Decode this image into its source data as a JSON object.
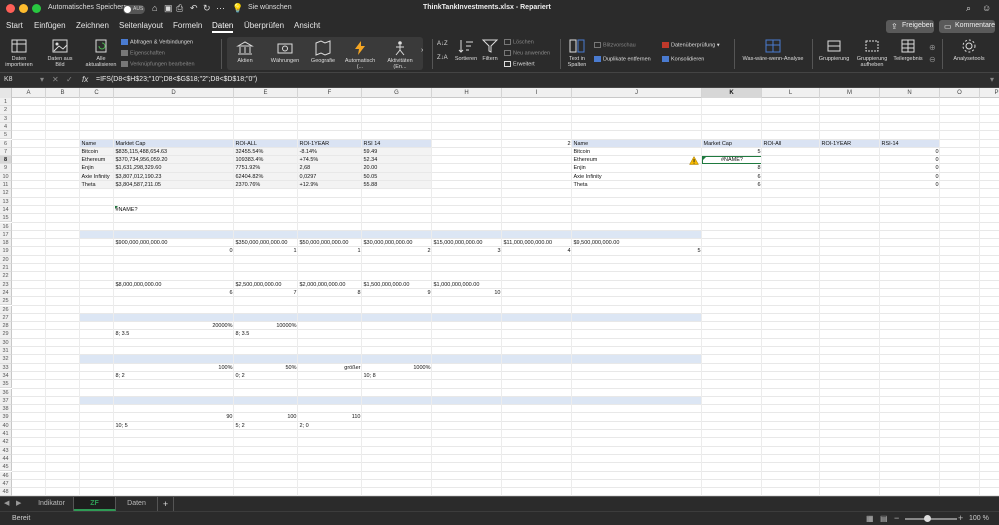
{
  "titlebar": {
    "autosave_label": "Automatisches Speichern",
    "autosave_state": "AUS",
    "search_hint": "Sie wünschen",
    "document_title": "ThinkTankInvestments.xlsx - Repariert"
  },
  "menu": {
    "items": [
      "Start",
      "Einfügen",
      "Zeichnen",
      "Seitenlayout",
      "Formeln",
      "Daten",
      "Überprüfen",
      "Ansicht"
    ],
    "active": "Daten",
    "share_label": "Freigeben",
    "comments_label": "Kommentare"
  },
  "ribbon": {
    "daten_importieren": "Daten importieren",
    "daten_aus_bild": "Daten aus Bild",
    "alle_aktualisieren": "Alle aktualisieren",
    "abfragen": "Abfragen & Verbindungen",
    "eigenschaften": "Eigenschaften",
    "verknuepfungen": "Verknüpfungen bearbeiten",
    "aktien": "Aktien",
    "waehrungen": "Währungen",
    "geografie": "Geografie",
    "automatisch": "Automatisch (...",
    "aktivitaeten": "Aktivitäten (En...",
    "sortieren": "Sortieren",
    "filtern": "Filtern",
    "loeschen": "Löschen",
    "neu_anwenden": "Neu anwenden",
    "erweitert": "Erweitert",
    "text_in_spalten": "Text in Spalten",
    "blitzvorschau": "Blitzvorschau",
    "duplikate": "Duplikate entfernen",
    "datenueberpruefung": "Datenüberprüfung",
    "konsolidieren": "Konsolidieren",
    "was_waere_wenn": "Was-wäre-wenn-Analyse",
    "gruppierung": "Gruppierung",
    "gruppierung_aufheben": "Gruppierung aufheben",
    "teilergebnis": "Teilergebnis",
    "analysetools": "Analysetools"
  },
  "formulabar": {
    "namebox": "K8",
    "formula": "=IFS(D8<$H$23;\"10\";D8<$G$18;\"2\";D8<$D$18;\"0\")"
  },
  "grid": {
    "columns": [
      "A",
      "B",
      "C",
      "D",
      "E",
      "F",
      "G",
      "H",
      "I",
      "J",
      "K",
      "L",
      "M",
      "N",
      "O",
      "P",
      "Q"
    ],
    "selected_column": "K",
    "selected_row": "8",
    "row_count": 48,
    "cells": {
      "C6": "Name",
      "D6": "Marktet Cap",
      "E6": "ROI-ALL",
      "F6": "ROI-1YEAR",
      "G6": "RSI 14",
      "C7": "Bitcoin",
      "D7": "$835,115,488,654.63",
      "E7": "32455.54%",
      "F7": "-8.14%",
      "G7": "59.49",
      "C8": "Ethereum",
      "D8": "$370,734,956,059.20",
      "E8": "109383.4%",
      "F8": "+74.5%",
      "G8": "52.34",
      "C9": "Enjin",
      "D9": "$1,631,298,329.60",
      "E9": "7751.92%",
      "F9": "2,68",
      "G9": "20.00",
      "C10": "Axie Infinity",
      "D10": "$3,807,012,190.23",
      "E10": "62404.82%",
      "F10": "0,0297",
      "G10": "50.05",
      "C11": "Theta",
      "D11": "$3,804,587,211.05",
      "E11": "2370.76%",
      "F11": "+12.9%",
      "G11": "55.88",
      "I6": "2",
      "J6": "Name",
      "K6": "Market Cap",
      "L6": "ROI-All",
      "M6": "ROI-1YEAR",
      "N6": "RSI-14",
      "J7": "Bitcoin",
      "K7": "5",
      "N7": "0",
      "J8": "Ethereum",
      "K8": "#NAME?",
      "N8": "0",
      "J9": "Enjin",
      "K9": "8",
      "N9": "0",
      "J10": "Axie Infinity",
      "K10": "6",
      "N10": "0",
      "J11": "Theta",
      "K11": "6",
      "N11": "0",
      "D14": "#NAME?",
      "D18": "$900,000,000,000.00",
      "E18": "$350,000,000,000.00",
      "F18": "$50,000,000,000.00",
      "G18": "$30,000,000,000.00",
      "H18": "$15,000,000,000.00",
      "I18": "$11,000,000,000.00",
      "J18": "$9,500,000,000.00",
      "D19": "0",
      "E19": "1",
      "F19": "1",
      "G19": "2",
      "H19": "3",
      "I19": "4",
      "J19": "5",
      "D23": "$8,000,000,000.00",
      "E23": "$2,500,000,000.00",
      "F23": "$2,000,000,000.00",
      "G23": "$1,500,000,000.00",
      "H23": "$1,000,000,000.00",
      "D24": "6",
      "E24": "7",
      "F24": "8",
      "G24": "9",
      "H24": "10",
      "D28": "20000%",
      "E28": "10000%",
      "D29": "8; 3.5",
      "E29": "8; 3.5",
      "D33": "100%",
      "E33": "50%",
      "F33": "größer",
      "G33": "1000%",
      "D34": "8; 2",
      "E34": "0; 2",
      "G34": "10; 8",
      "D39": "90",
      "E39": "100",
      "F39": "110",
      "D40": "10; 5",
      "E40": "5; 2",
      "F40": "2; 0"
    }
  },
  "sheets": {
    "tabs": [
      "Indikator",
      "ZF",
      "Daten"
    ],
    "active": "ZF",
    "add_label": "+"
  },
  "status": {
    "text": "Bereit",
    "zoom": "100 %"
  },
  "colors": {
    "chrome": "#2b2b2b",
    "accent_green": "#1f7a3f",
    "header_band": "#dae3f3",
    "separator_band": "#dce6f4"
  }
}
